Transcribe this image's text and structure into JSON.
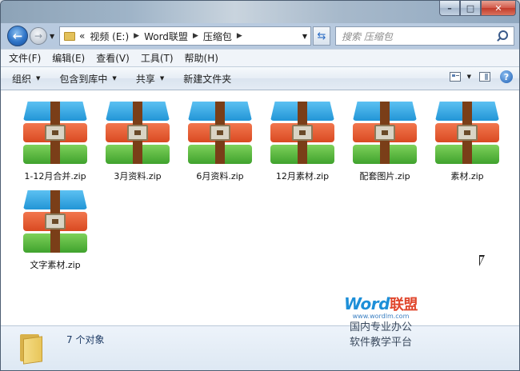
{
  "window": {
    "caption_buttons": [
      "–",
      "□",
      "✕"
    ]
  },
  "nav": {
    "back_glyph": "←",
    "forward_glyph": "→",
    "breadcrumb": [
      "视频 (E:)",
      "Word联盟",
      "压缩包"
    ],
    "overflow": "«",
    "search_placeholder": "搜索 压缩包"
  },
  "menu": [
    "文件(F)",
    "编辑(E)",
    "查看(V)",
    "工具(T)",
    "帮助(H)"
  ],
  "commands": [
    {
      "label": "组织",
      "dropdown": true
    },
    {
      "label": "包含到库中",
      "dropdown": true
    },
    {
      "label": "共享",
      "dropdown": true
    },
    {
      "label": "新建文件夹",
      "dropdown": false
    }
  ],
  "help_glyph": "?",
  "files": [
    {
      "name": "1-12月合并.zip",
      "icon": "zip-archive-icon"
    },
    {
      "name": "3月资料.zip",
      "icon": "zip-archive-icon"
    },
    {
      "name": "6月资料.zip",
      "icon": "zip-archive-icon"
    },
    {
      "name": "12月素材.zip",
      "icon": "zip-archive-icon"
    },
    {
      "name": "配套图片.zip",
      "icon": "zip-archive-icon"
    },
    {
      "name": "素材.zip",
      "icon": "zip-archive-icon"
    },
    {
      "name": "文字素材.zip",
      "icon": "zip-archive-icon"
    }
  ],
  "details": {
    "count": "7 个对象"
  },
  "watermark": {
    "brand_latin": "Word",
    "brand_cn": "联盟",
    "url": "www.wordlm.com",
    "line1": "国内专业办公",
    "line2": "软件教学平台"
  },
  "colors": {
    "accent": "#1d8fd8",
    "zip_blue": "#2295d6",
    "zip_red": "#d94a22",
    "zip_green": "#3fa22d"
  }
}
